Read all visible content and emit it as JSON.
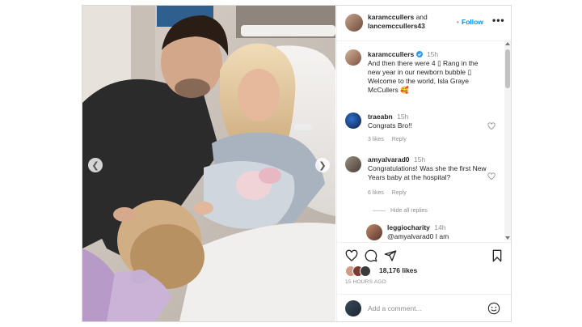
{
  "header": {
    "user_1": "karamccullers",
    "conjunction": "and",
    "user_2": "lancemccullers43",
    "follow_label": "Follow",
    "more_label": "•••",
    "separator": "•"
  },
  "caption": {
    "user": "karamccullers",
    "time": "15h",
    "text": "And then there were 4 ▯ Rang in the new year in our newborn bubble ▯ Welcome to the world, Isla Graye McCullers 🥰"
  },
  "comments": [
    {
      "user": "traeabn",
      "time": "15h",
      "text": "Congrats Bro!!",
      "likes": "3 likes",
      "reply": "Reply"
    },
    {
      "user": "amyalvarad0",
      "time": "15h",
      "text": "Congratulations! Was she the first New Years baby at the hospital?",
      "likes": "6 likes",
      "reply": "Reply"
    }
  ],
  "hide_replies": "Hide all replies",
  "reply_preview": {
    "user": "leggiocharity",
    "time": "14h",
    "text": "@amyalvarad0 I am"
  },
  "likes": {
    "count": "18,176 likes"
  },
  "timestamp": "15 HOURS AGO",
  "add_comment": {
    "placeholder": "Add a comment..."
  },
  "icons": [
    "chevron-left-icon",
    "chevron-right-icon",
    "heart-icon",
    "comment-icon",
    "share-icon",
    "bookmark-icon",
    "emoji-icon",
    "verified-icon"
  ],
  "colors": {
    "accent": "#0095f6",
    "text": "#262626",
    "muted": "#8e8e8e",
    "verified": "#3897f0"
  }
}
